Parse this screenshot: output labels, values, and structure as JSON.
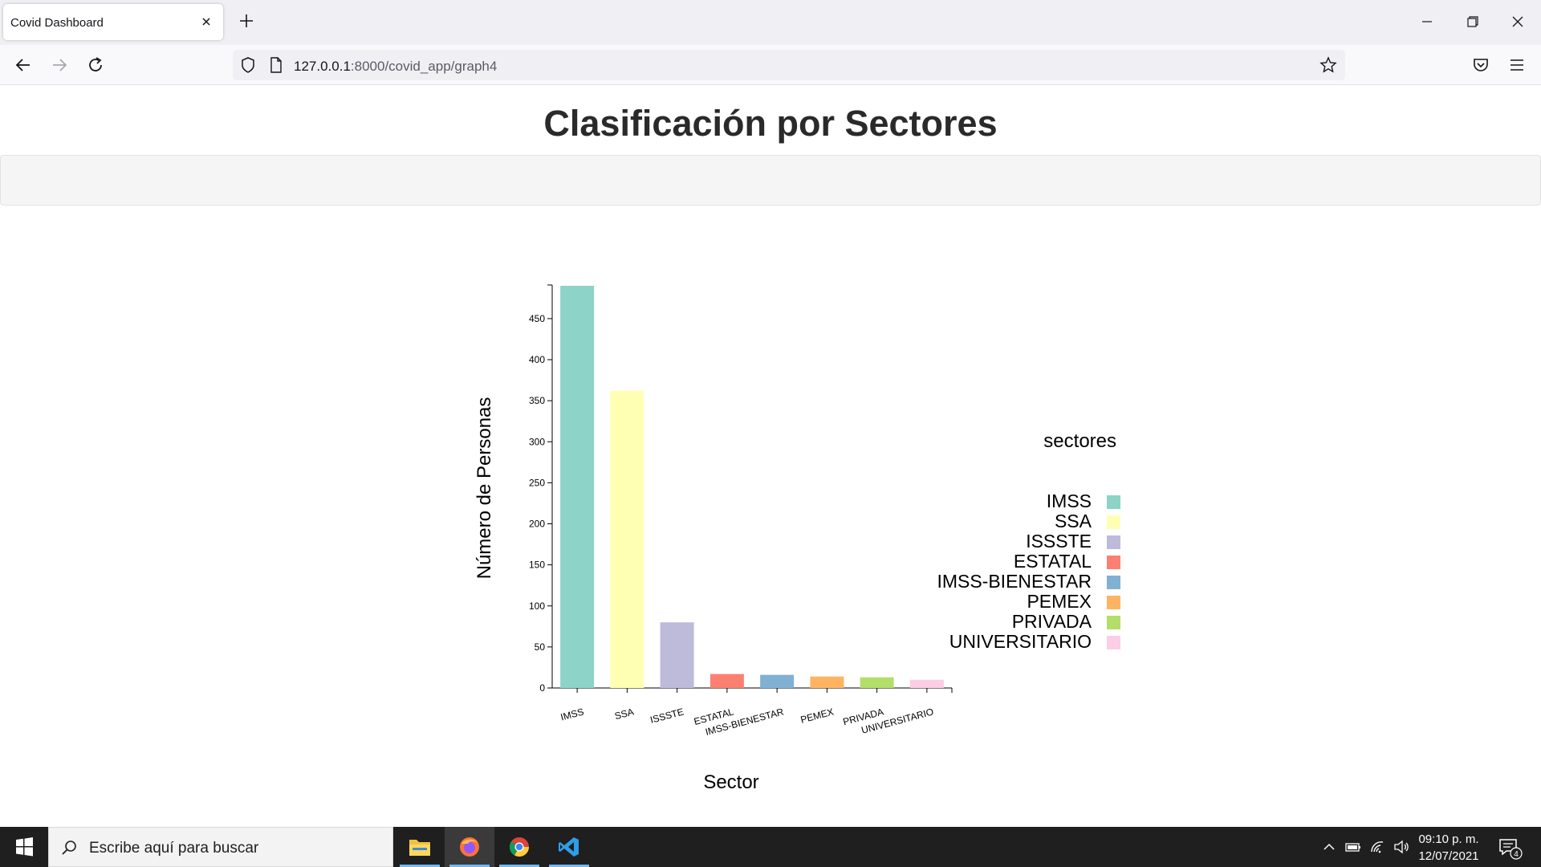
{
  "browser": {
    "tab_title": "Covid Dashboard",
    "url_host": "127.0.0.1",
    "url_path": ":8000/covid_app/graph4"
  },
  "page": {
    "title": "Clasificación por Sectores"
  },
  "chart_data": {
    "type": "bar",
    "xlabel": "Sector",
    "ylabel": "Número de Personas",
    "ylim": [
      0,
      490
    ],
    "yticks": [
      0,
      50,
      100,
      150,
      200,
      250,
      300,
      350,
      400,
      450
    ],
    "categories": [
      "IMSS",
      "SSA",
      "ISSSTE",
      "ESTATAL",
      "IMSS-BIENESTAR",
      "PEMEX",
      "PRIVADA",
      "UNIVERSITARIO"
    ],
    "values": [
      490,
      362,
      80,
      17,
      16,
      14,
      13,
      10
    ],
    "colors": [
      "#8dd3c7",
      "#ffffb3",
      "#bebada",
      "#fb8072",
      "#80b1d3",
      "#fdb462",
      "#b3de69",
      "#fccde5"
    ],
    "legend_title": "sectores",
    "legend_position": "right"
  },
  "taskbar": {
    "search_placeholder": "Escribe aquí para buscar",
    "time": "09:10 p. m.",
    "date": "12/07/2021",
    "notification_count": "4",
    "apps": [
      "file-explorer-icon",
      "firefox-icon",
      "chrome-icon",
      "vscode-icon"
    ]
  }
}
